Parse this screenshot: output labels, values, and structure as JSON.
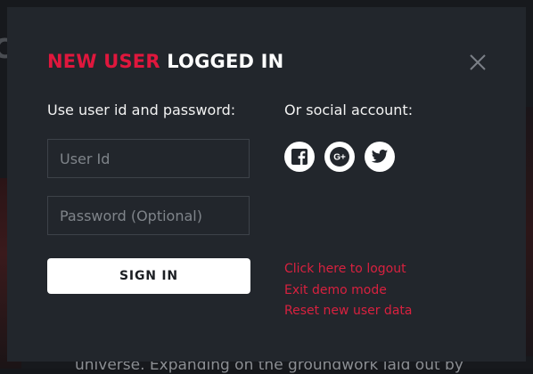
{
  "background": {
    "glyph": "C",
    "bottom_text": "universe. Expanding on the groundwork laid out by"
  },
  "modal": {
    "title_accent": "NEW USER",
    "title_rest": "LOGGED IN",
    "close_icon": "close-icon",
    "left_label": "Use user id and password:",
    "right_label": "Or social account:",
    "user_id_placeholder": "User Id",
    "password_placeholder": "Password (Optional)",
    "sign_in_label": "SIGN IN",
    "social": [
      {
        "name": "facebook-icon"
      },
      {
        "name": "google-plus-icon"
      },
      {
        "name": "twitter-icon"
      }
    ],
    "links": {
      "logout": "Click here to logout",
      "exit_demo": "Exit demo mode",
      "reset": "Reset new user data"
    }
  },
  "colors": {
    "accent": "#e0173d",
    "link": "#d8213f",
    "modal_bg": "#22262c",
    "text": "#f2f2f2"
  }
}
